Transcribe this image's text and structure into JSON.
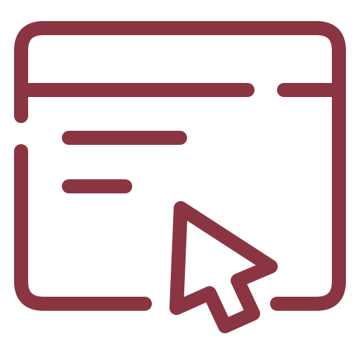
{
  "icon": {
    "name": "browser-window-click-icon",
    "stroke_color": "#8b3542",
    "background_color": "#ffffff"
  }
}
